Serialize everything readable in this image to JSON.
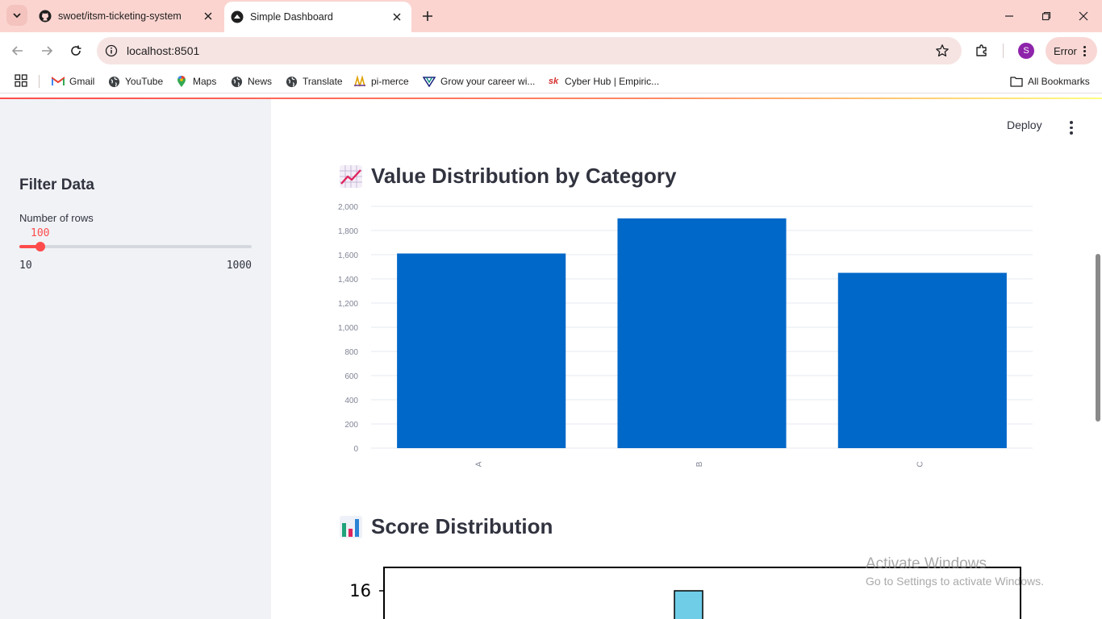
{
  "browser": {
    "tabs": [
      {
        "title": "swoet/itsm-ticketing-system",
        "icon": "github-icon",
        "active": false
      },
      {
        "title": "Simple Dashboard",
        "icon": "streamlit-icon",
        "active": true
      }
    ],
    "url": "localhost:8501",
    "profile_initial": "S",
    "error_label": "Error",
    "bookmarks": [
      {
        "label": "Gmail",
        "icon": "gmail-icon"
      },
      {
        "label": "YouTube",
        "icon": "globe-icon"
      },
      {
        "label": "Maps",
        "icon": "maps-pin-icon"
      },
      {
        "label": "News",
        "icon": "globe-icon"
      },
      {
        "label": "Translate",
        "icon": "globe-icon"
      },
      {
        "label": "pi-merce",
        "icon": "pima-icon"
      },
      {
        "label": "Grow your career wi...",
        "icon": "career-icon"
      },
      {
        "label": "Cyber Hub | Empiric...",
        "icon": "sk-icon"
      }
    ],
    "all_bookmarks": "All Bookmarks"
  },
  "app": {
    "deploy_label": "Deploy",
    "sidebar": {
      "title": "Filter Data",
      "slider_label": "Number of rows",
      "slider_value": "100",
      "slider_min": "10",
      "slider_max": "1000",
      "slider_fraction": 0.091
    },
    "headings": {
      "chart1": "Value Distribution by Category",
      "chart2": "Score Distribution"
    }
  },
  "chart_data": [
    {
      "type": "bar",
      "categories": [
        "A",
        "B",
        "C"
      ],
      "values": [
        1610,
        1900,
        1450
      ],
      "ylim": [
        0,
        2000
      ],
      "yticks": [
        0,
        200,
        400,
        600,
        800,
        1000,
        1200,
        1400,
        1600,
        1800,
        2000
      ],
      "ytick_labels": [
        "0",
        "200",
        "400",
        "600",
        "800",
        "1,000",
        "1,200",
        "1,400",
        "1,600",
        "1,800",
        "2,000"
      ],
      "color": "#0068c9",
      "grid": true,
      "title": "",
      "xlabel": "",
      "ylabel": ""
    },
    {
      "type": "bar",
      "visible_ytick": "16",
      "color": "#6fcde8",
      "title": "",
      "xlabel": "",
      "ylabel": ""
    }
  ],
  "system": {
    "watermark_line1": "Activate Windows",
    "watermark_line2": "Go to Settings to activate Windows."
  }
}
